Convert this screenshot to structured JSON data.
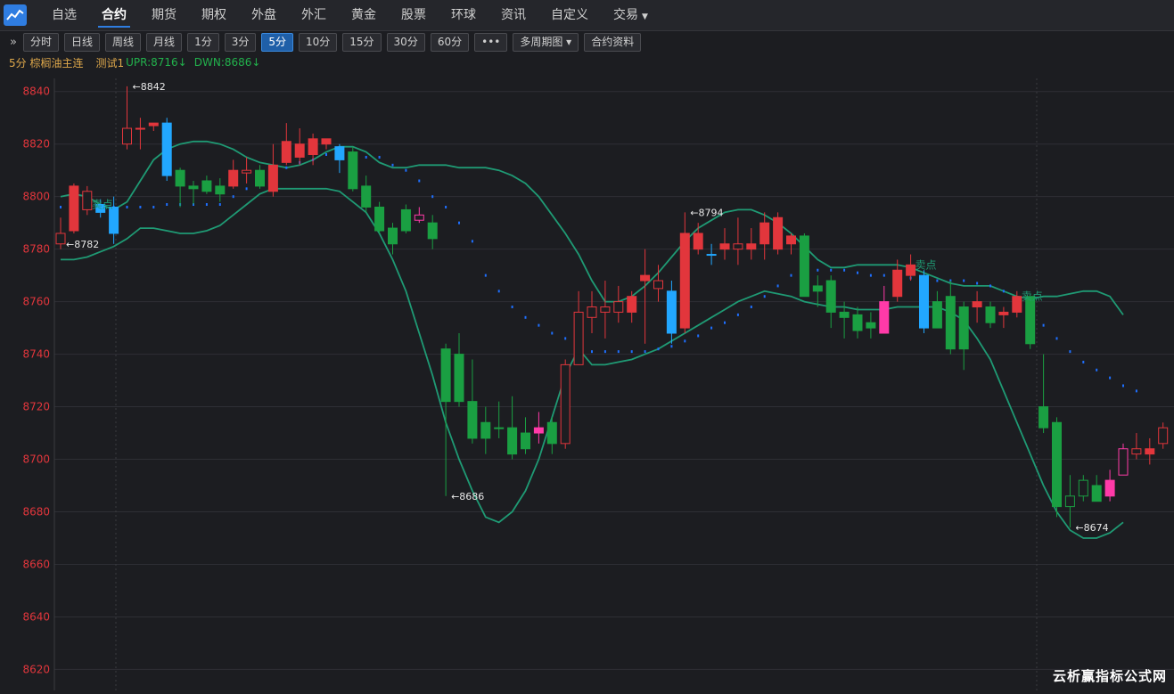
{
  "nav": {
    "items": [
      {
        "label": "自选",
        "active": false
      },
      {
        "label": "合约",
        "active": true
      },
      {
        "label": "期货",
        "active": false
      },
      {
        "label": "期权",
        "active": false
      },
      {
        "label": "外盘",
        "active": false
      },
      {
        "label": "外汇",
        "active": false
      },
      {
        "label": "黄金",
        "active": false
      },
      {
        "label": "股票",
        "active": false
      },
      {
        "label": "环球",
        "active": false
      },
      {
        "label": "资讯",
        "active": false
      },
      {
        "label": "自定义",
        "active": false
      },
      {
        "label": "交易",
        "active": false,
        "dropdown": true
      }
    ]
  },
  "toolbar": {
    "expand_icon": "»",
    "buttons": [
      {
        "label": "分时",
        "active": false
      },
      {
        "label": "日线",
        "active": false
      },
      {
        "label": "周线",
        "active": false
      },
      {
        "label": "月线",
        "active": false
      },
      {
        "label": "1分",
        "active": false
      },
      {
        "label": "3分",
        "active": false
      },
      {
        "label": "5分",
        "active": true
      },
      {
        "label": "10分",
        "active": false
      },
      {
        "label": "15分",
        "active": false
      },
      {
        "label": "30分",
        "active": false
      },
      {
        "label": "60分",
        "active": false
      },
      {
        "label": "•••",
        "active": false
      },
      {
        "label": "多周期图 ▾",
        "active": false
      },
      {
        "label": "合约资料",
        "active": false
      }
    ]
  },
  "info": {
    "contract": "5分 棕榈油主连",
    "indicator": "测试1",
    "upr": "UPR:8716",
    "dwn": "DWN:8686",
    "arrow": "↓"
  },
  "watermark": "云析赢指标公式网",
  "colors": {
    "up": "#e2363c",
    "down": "#1a9f42",
    "blue": "#22a7ff",
    "magenta": "#ff3aa8",
    "band": "#1f9a74",
    "sar": "#1e6fff",
    "axis": "#e2363c",
    "annot": "#e8e8e8"
  },
  "chart_data": {
    "type": "candlestick",
    "ylim": [
      8612,
      8845
    ],
    "yticks": [
      8840,
      8820,
      8800,
      8780,
      8760,
      8740,
      8720,
      8700,
      8680,
      8660,
      8640,
      8620
    ],
    "candles": [
      {
        "o": 8782,
        "h": 8792,
        "l": 8780,
        "c": 8786,
        "k": "up"
      },
      {
        "o": 8804,
        "h": 8805,
        "l": 8786,
        "c": 8787,
        "k": "up"
      },
      {
        "o": 8795,
        "h": 8804,
        "l": 8793,
        "c": 8802,
        "k": "up"
      },
      {
        "o": 8794,
        "h": 8799,
        "l": 8792,
        "c": 8797,
        "k": "blue"
      },
      {
        "o": 8796,
        "h": 8800,
        "l": 8782,
        "c": 8786,
        "k": "blue"
      },
      {
        "o": 8820,
        "h": 8842,
        "l": 8818,
        "c": 8826,
        "k": "up"
      },
      {
        "o": 8826,
        "h": 8830,
        "l": 8818,
        "c": 8826,
        "k": "up"
      },
      {
        "o": 8828,
        "h": 8828,
        "l": 8825,
        "c": 8827,
        "k": "up"
      },
      {
        "o": 8828,
        "h": 8830,
        "l": 8806,
        "c": 8808,
        "k": "blue"
      },
      {
        "o": 8810,
        "h": 8811,
        "l": 8796,
        "c": 8804,
        "k": "down"
      },
      {
        "o": 8804,
        "h": 8806,
        "l": 8797,
        "c": 8803,
        "k": "down"
      },
      {
        "o": 8806,
        "h": 8808,
        "l": 8801,
        "c": 8802,
        "k": "down"
      },
      {
        "o": 8804,
        "h": 8807,
        "l": 8798,
        "c": 8801,
        "k": "down"
      },
      {
        "o": 8810,
        "h": 8814,
        "l": 8803,
        "c": 8804,
        "k": "up"
      },
      {
        "o": 8809,
        "h": 8815,
        "l": 8805,
        "c": 8810,
        "k": "up"
      },
      {
        "o": 8810,
        "h": 8812,
        "l": 8803,
        "c": 8804,
        "k": "down"
      },
      {
        "o": 8812,
        "h": 8820,
        "l": 8800,
        "c": 8802,
        "k": "up"
      },
      {
        "o": 8821,
        "h": 8828,
        "l": 8812,
        "c": 8813,
        "k": "up"
      },
      {
        "o": 8820,
        "h": 8826,
        "l": 8812,
        "c": 8815,
        "k": "up"
      },
      {
        "o": 8822,
        "h": 8824,
        "l": 8812,
        "c": 8816,
        "k": "up"
      },
      {
        "o": 8822,
        "h": 8822,
        "l": 8818,
        "c": 8820,
        "k": "up"
      },
      {
        "o": 8819,
        "h": 8820,
        "l": 8809,
        "c": 8814,
        "k": "blue"
      },
      {
        "o": 8817,
        "h": 8819,
        "l": 8802,
        "c": 8803,
        "k": "down"
      },
      {
        "o": 8804,
        "h": 8808,
        "l": 8794,
        "c": 8796,
        "k": "down"
      },
      {
        "o": 8796,
        "h": 8798,
        "l": 8786,
        "c": 8787,
        "k": "down"
      },
      {
        "o": 8788,
        "h": 8790,
        "l": 8778,
        "c": 8782,
        "k": "down"
      },
      {
        "o": 8795,
        "h": 8797,
        "l": 8786,
        "c": 8787,
        "k": "down"
      },
      {
        "o": 8791,
        "h": 8796,
        "l": 8790,
        "c": 8793,
        "k": "magenta"
      },
      {
        "o": 8790,
        "h": 8793,
        "l": 8780,
        "c": 8784,
        "k": "down"
      },
      {
        "o": 8742,
        "h": 8744,
        "l": 8686,
        "c": 8722,
        "k": "down"
      },
      {
        "o": 8740,
        "h": 8748,
        "l": 8720,
        "c": 8722,
        "k": "down"
      },
      {
        "o": 8722,
        "h": 8738,
        "l": 8706,
        "c": 8708,
        "k": "down"
      },
      {
        "o": 8714,
        "h": 8720,
        "l": 8702,
        "c": 8708,
        "k": "down"
      },
      {
        "o": 8712,
        "h": 8722,
        "l": 8708,
        "c": 8712,
        "k": "down"
      },
      {
        "o": 8712,
        "h": 8724,
        "l": 8700,
        "c": 8702,
        "k": "down"
      },
      {
        "o": 8710,
        "h": 8716,
        "l": 8702,
        "c": 8704,
        "k": "down"
      },
      {
        "o": 8712,
        "h": 8718,
        "l": 8706,
        "c": 8710,
        "k": "magenta"
      },
      {
        "o": 8714,
        "h": 8716,
        "l": 8702,
        "c": 8706,
        "k": "down"
      },
      {
        "o": 8706,
        "h": 8738,
        "l": 8704,
        "c": 8736,
        "k": "up"
      },
      {
        "o": 8736,
        "h": 8764,
        "l": 8736,
        "c": 8756,
        "k": "up"
      },
      {
        "o": 8754,
        "h": 8764,
        "l": 8748,
        "c": 8758,
        "k": "up"
      },
      {
        "o": 8756,
        "h": 8768,
        "l": 8746,
        "c": 8758,
        "k": "up"
      },
      {
        "o": 8756,
        "h": 8766,
        "l": 8752,
        "c": 8760,
        "k": "up"
      },
      {
        "o": 8762,
        "h": 8764,
        "l": 8752,
        "c": 8756,
        "k": "up"
      },
      {
        "o": 8770,
        "h": 8780,
        "l": 8744,
        "c": 8768,
        "k": "up"
      },
      {
        "o": 8765,
        "h": 8774,
        "l": 8760,
        "c": 8768,
        "k": "up"
      },
      {
        "o": 8764,
        "h": 8768,
        "l": 8744,
        "c": 8748,
        "k": "blue"
      },
      {
        "o": 8786,
        "h": 8794,
        "l": 8748,
        "c": 8750,
        "k": "up"
      },
      {
        "o": 8786,
        "h": 8790,
        "l": 8778,
        "c": 8780,
        "k": "up"
      },
      {
        "o": 8778,
        "h": 8782,
        "l": 8774,
        "c": 8778,
        "k": "blue"
      },
      {
        "o": 8782,
        "h": 8788,
        "l": 8776,
        "c": 8780,
        "k": "up"
      },
      {
        "o": 8780,
        "h": 8792,
        "l": 8774,
        "c": 8782,
        "k": "up"
      },
      {
        "o": 8782,
        "h": 8788,
        "l": 8776,
        "c": 8780,
        "k": "up"
      },
      {
        "o": 8790,
        "h": 8794,
        "l": 8776,
        "c": 8782,
        "k": "up"
      },
      {
        "o": 8792,
        "h": 8794,
        "l": 8778,
        "c": 8780,
        "k": "up"
      },
      {
        "o": 8785,
        "h": 8786,
        "l": 8778,
        "c": 8782,
        "k": "up"
      },
      {
        "o": 8785,
        "h": 8786,
        "l": 8762,
        "c": 8762,
        "k": "down"
      },
      {
        "o": 8766,
        "h": 8770,
        "l": 8758,
        "c": 8764,
        "k": "down"
      },
      {
        "o": 8768,
        "h": 8770,
        "l": 8750,
        "c": 8756,
        "k": "down"
      },
      {
        "o": 8756,
        "h": 8760,
        "l": 8746,
        "c": 8754,
        "k": "down"
      },
      {
        "o": 8755,
        "h": 8758,
        "l": 8746,
        "c": 8749,
        "k": "down"
      },
      {
        "o": 8752,
        "h": 8756,
        "l": 8746,
        "c": 8750,
        "k": "down"
      },
      {
        "o": 8760,
        "h": 8766,
        "l": 8748,
        "c": 8748,
        "k": "magenta"
      },
      {
        "o": 8772,
        "h": 8776,
        "l": 8760,
        "c": 8762,
        "k": "up"
      },
      {
        "o": 8774,
        "h": 8778,
        "l": 8768,
        "c": 8770,
        "k": "up"
      },
      {
        "o": 8770,
        "h": 8772,
        "l": 8748,
        "c": 8750,
        "k": "blue"
      },
      {
        "o": 8760,
        "h": 8764,
        "l": 8750,
        "c": 8750,
        "k": "down"
      },
      {
        "o": 8762,
        "h": 8768,
        "l": 8740,
        "c": 8742,
        "k": "down"
      },
      {
        "o": 8758,
        "h": 8760,
        "l": 8734,
        "c": 8742,
        "k": "down"
      },
      {
        "o": 8760,
        "h": 8764,
        "l": 8752,
        "c": 8758,
        "k": "up"
      },
      {
        "o": 8758,
        "h": 8760,
        "l": 8750,
        "c": 8752,
        "k": "down"
      },
      {
        "o": 8756,
        "h": 8758,
        "l": 8750,
        "c": 8755,
        "k": "up"
      },
      {
        "o": 8762,
        "h": 8764,
        "l": 8754,
        "c": 8756,
        "k": "up"
      },
      {
        "o": 8762,
        "h": 8762,
        "l": 8742,
        "c": 8744,
        "k": "down"
      },
      {
        "o": 8720,
        "h": 8740,
        "l": 8710,
        "c": 8712,
        "k": "down"
      },
      {
        "o": 8714,
        "h": 8716,
        "l": 8678,
        "c": 8682,
        "k": "down"
      },
      {
        "o": 8682,
        "h": 8694,
        "l": 8674,
        "c": 8686,
        "k": "down"
      },
      {
        "o": 8686,
        "h": 8694,
        "l": 8684,
        "c": 8692,
        "k": "down"
      },
      {
        "o": 8690,
        "h": 8694,
        "l": 8684,
        "c": 8684,
        "k": "down"
      },
      {
        "o": 8692,
        "h": 8696,
        "l": 8684,
        "c": 8686,
        "k": "magenta"
      },
      {
        "o": 8694,
        "h": 8706,
        "l": 8694,
        "c": 8704,
        "k": "magenta"
      },
      {
        "o": 8702,
        "h": 8710,
        "l": 8700,
        "c": 8704,
        "k": "up"
      },
      {
        "o": 8704,
        "h": 8708,
        "l": 8698,
        "c": 8702,
        "k": "up"
      },
      {
        "o": 8706,
        "h": 8714,
        "l": 8704,
        "c": 8712,
        "k": "up"
      }
    ],
    "upper_band": [
      8800,
      8801,
      8800,
      8797,
      8795,
      8798,
      8806,
      8814,
      8818,
      8820,
      8821,
      8821,
      8820,
      8818,
      8815,
      8813,
      8812,
      8811,
      8812,
      8814,
      8817,
      8819,
      8819,
      8817,
      8813,
      8811,
      8811,
      8812,
      8812,
      8812,
      8811,
      8811,
      8811,
      8810,
      8808,
      8805,
      8800,
      8793,
      8786,
      8778,
      8768,
      8760,
      8760,
      8762,
      8766,
      8771,
      8777,
      8783,
      8788,
      8791,
      8794,
      8795,
      8795,
      8793,
      8790,
      8786,
      8781,
      8776,
      8773,
      8773,
      8774,
      8774,
      8774,
      8774,
      8773,
      8771,
      8769,
      8767,
      8766,
      8766,
      8766,
      8764,
      8762,
      8761,
      8762,
      8762,
      8763,
      8764,
      8764,
      8762,
      8755
    ],
    "lower_band": [
      8776,
      8776,
      8777,
      8779,
      8781,
      8784,
      8788,
      8788,
      8787,
      8786,
      8786,
      8787,
      8789,
      8793,
      8797,
      8801,
      8803,
      8803,
      8803,
      8803,
      8803,
      8802,
      8798,
      8794,
      8786,
      8776,
      8764,
      8748,
      8732,
      8714,
      8700,
      8688,
      8678,
      8676,
      8680,
      8688,
      8700,
      8716,
      8732,
      8742,
      8736,
      8736,
      8737,
      8738,
      8740,
      8742,
      8745,
      8748,
      8751,
      8754,
      8757,
      8760,
      8762,
      8764,
      8763,
      8762,
      8760,
      8759,
      8758,
      8758,
      8757,
      8757,
      8757,
      8758,
      8758,
      8758,
      8758,
      8756,
      8753,
      8746,
      8738,
      8726,
      8714,
      8702,
      8690,
      8680,
      8673,
      8670,
      8670,
      8672,
      8676
    ],
    "sar": [
      8796,
      8796,
      8796,
      8796,
      8796,
      8796,
      8796,
      8796,
      8797,
      8797,
      8797,
      8797,
      8797,
      8800,
      8803,
      8806,
      8808,
      8811,
      8813,
      8814,
      8816,
      8816,
      8815,
      8815,
      8815,
      8812,
      8810,
      8806,
      8800,
      8796,
      8790,
      8783,
      8770,
      8764,
      8758,
      8754,
      8751,
      8748,
      8746,
      8742,
      8741,
      8741,
      8741,
      8741,
      8741,
      8742,
      8743,
      8745,
      8747,
      8750,
      8752,
      8755,
      8758,
      8762,
      8766,
      8770,
      8772,
      8772,
      8772,
      8772,
      8771,
      8770,
      8770,
      8770,
      8769,
      8769,
      8768,
      8768,
      8768,
      8767,
      8766,
      8764,
      8760,
      8756,
      8751,
      8746,
      8741,
      8737,
      8734,
      8731,
      8728,
      8726
    ],
    "annotations": [
      {
        "i": 5,
        "price": 8842,
        "text": "←8842"
      },
      {
        "i": 0,
        "price": 8782,
        "text": "←8782"
      },
      {
        "i": 29,
        "price": 8686,
        "text": "←8686"
      },
      {
        "i": 47,
        "price": 8794,
        "text": "←8794"
      },
      {
        "i": 76,
        "price": 8674,
        "text": "←8674"
      }
    ],
    "signals": [
      {
        "i": 3,
        "price": 8797,
        "text": "卖点"
      },
      {
        "i": 65,
        "price": 8774,
        "text": "卖点"
      },
      {
        "i": 73,
        "price": 8762,
        "text": "卖点"
      }
    ]
  }
}
